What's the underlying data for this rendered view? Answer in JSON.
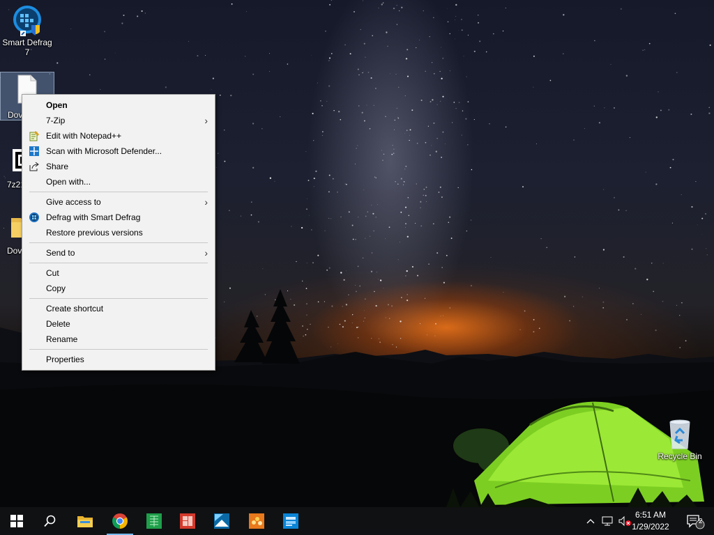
{
  "desktop": {
    "icons": [
      {
        "label": "Smart Defrag 7",
        "icon": "smart-defrag-icon"
      },
      {
        "label": "Dov",
        "icon": "document-file-icon"
      },
      {
        "label": "7z21",
        "icon": "exe-file-icon"
      },
      {
        "label": "Dov",
        "icon": "folder-icon"
      },
      {
        "label": "Recycle Bin",
        "icon": "recycle-bin-icon"
      }
    ]
  },
  "context_menu": {
    "items": [
      {
        "label": "Open"
      },
      {
        "label": "7-Zip"
      },
      {
        "label": "Edit with Notepad++",
        "icon": "notepadpp-icon"
      },
      {
        "label": "Scan with Microsoft Defender...",
        "icon": "defender-icon"
      },
      {
        "label": "Share",
        "icon": "share-icon"
      },
      {
        "label": "Open with..."
      },
      {
        "label": "Give access to"
      },
      {
        "label": "Defrag with Smart Defrag",
        "icon": "smart-defrag-icon"
      },
      {
        "label": "Restore previous versions"
      },
      {
        "label": "Send to"
      },
      {
        "label": "Cut"
      },
      {
        "label": "Copy"
      },
      {
        "label": "Create shortcut"
      },
      {
        "label": "Delete"
      },
      {
        "label": "Rename"
      },
      {
        "label": "Properties"
      }
    ]
  },
  "taskbar": {
    "apps": [
      "start-icon",
      "search-icon",
      "file-explorer-icon",
      "chrome-icon",
      "spreadsheet-app-icon",
      "presentation-app-icon",
      "photo-app-icon",
      "paint-app-icon",
      "blue-app-icon"
    ],
    "tray": {
      "time": "6:51 AM",
      "date": "1/29/2022",
      "notifications": "2"
    }
  },
  "colors": {
    "menu_bg": "#f2f2f2",
    "taskbar_bg": "#101113",
    "accent": "#76b9ed"
  }
}
